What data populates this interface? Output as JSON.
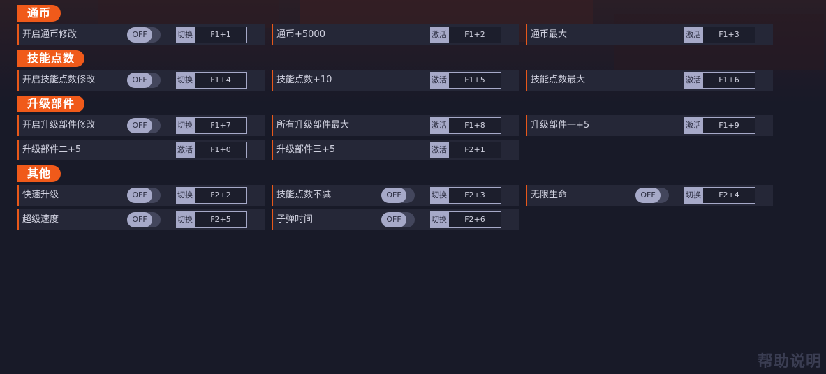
{
  "sections": {
    "coins": {
      "title": "通币",
      "rows": [
        {
          "label": "开启通币修改",
          "toggle": "OFF",
          "action": "切换",
          "key": "F1+1"
        },
        {
          "label": "通币+5000",
          "action": "激活",
          "key": "F1+2"
        },
        {
          "label": "通币最大",
          "action": "激活",
          "key": "F1+3"
        }
      ]
    },
    "skill_points": {
      "title": "技能点数",
      "rows": [
        {
          "label": "开启技能点数修改",
          "toggle": "OFF",
          "action": "切换",
          "key": "F1+4"
        },
        {
          "label": "技能点数+10",
          "action": "激活",
          "key": "F1+5"
        },
        {
          "label": "技能点数最大",
          "action": "激活",
          "key": "F1+6"
        }
      ]
    },
    "upgrade_parts": {
      "title": "升级部件",
      "rows": [
        {
          "label": "开启升级部件修改",
          "toggle": "OFF",
          "action": "切换",
          "key": "F1+7"
        },
        {
          "label": "所有升级部件最大",
          "action": "激活",
          "key": "F1+8"
        },
        {
          "label": "升级部件一+5",
          "action": "激活",
          "key": "F1+9"
        },
        {
          "label": "升级部件二+5",
          "action": "激活",
          "key": "F1+0"
        },
        {
          "label": "升级部件三+5",
          "action": "激活",
          "key": "F2+1"
        }
      ]
    },
    "other": {
      "title": "其他",
      "rows": [
        {
          "label": "快速升级",
          "toggle": "OFF",
          "action": "切换",
          "key": "F2+2"
        },
        {
          "label": "技能点数不减",
          "toggle": "OFF",
          "action": "切换",
          "key": "F2+3"
        },
        {
          "label": "无限生命",
          "toggle": "OFF",
          "action": "切换",
          "key": "F2+4"
        },
        {
          "label": "超级速度",
          "toggle": "OFF",
          "action": "切换",
          "key": "F2+5"
        },
        {
          "label": "子弹时间",
          "toggle": "OFF",
          "action": "切换",
          "key": "F2+6"
        }
      ]
    }
  },
  "footer": {
    "help_label": "帮助说明"
  }
}
